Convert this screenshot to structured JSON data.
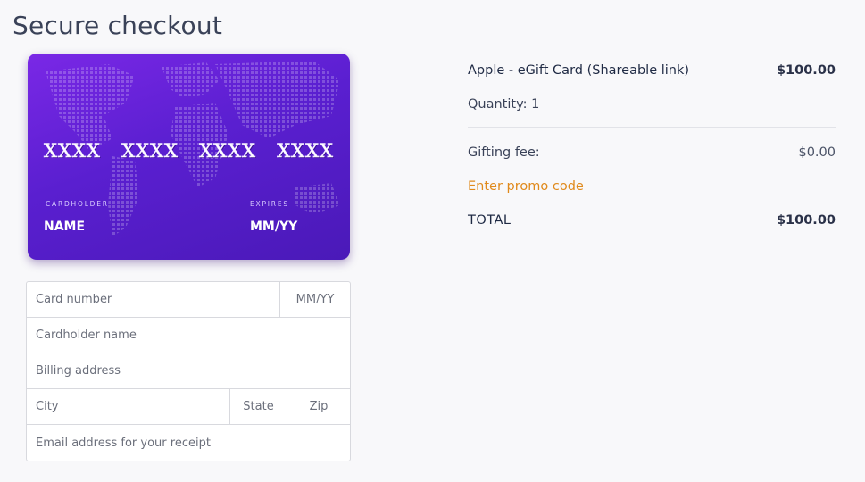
{
  "page": {
    "title": "Secure checkout"
  },
  "card_preview": {
    "number_groups": [
      "XXXX",
      "XXXX",
      "XXXX",
      "XXXX"
    ],
    "cardholder_label": "CARDHOLDER",
    "cardholder_value": "NAME",
    "expires_label": "EXPIRES",
    "expires_value": "MM/YY",
    "gradient_start": "#7a28e6",
    "gradient_end": "#4a19b8"
  },
  "form": {
    "card_number_placeholder": "Card number",
    "expiry_placeholder": "MM/YY",
    "cardholder_placeholder": "Cardholder name",
    "billing_placeholder": "Billing address",
    "city_placeholder": "City",
    "state_placeholder": "State",
    "zip_placeholder": "Zip",
    "email_placeholder": "Email address for your receipt"
  },
  "summary": {
    "product_name": "Apple - eGift Card (Shareable link)",
    "product_price": "$100.00",
    "quantity_text": "Quantity: 1",
    "fee_label": "Gifting fee:",
    "fee_amount": "$0.00",
    "promo_link": "Enter promo code",
    "total_label": "TOTAL",
    "total_amount": "$100.00",
    "accent_color": "#e08a1c"
  }
}
